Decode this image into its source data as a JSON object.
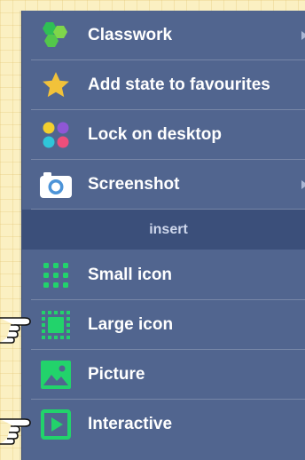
{
  "menu": {
    "items": [
      {
        "label": "Classwork",
        "icon": "green-blobs-icon",
        "has_submenu": true
      },
      {
        "label": "Add state to favourites",
        "icon": "star-icon",
        "has_submenu": false
      },
      {
        "label": "Lock on desktop",
        "icon": "colored-dots-icon",
        "has_submenu": false
      },
      {
        "label": "Screenshot",
        "icon": "camera-icon",
        "has_submenu": true
      }
    ],
    "section_header": "insert",
    "insert_items": [
      {
        "label": "Small icon",
        "icon": "dot-grid-icon"
      },
      {
        "label": "Large icon",
        "icon": "large-icon-frame-icon"
      },
      {
        "label": "Picture",
        "icon": "picture-icon"
      },
      {
        "label": "Interactive",
        "icon": "play-button-icon"
      }
    ]
  },
  "colors": {
    "menu_bg": "#51658f",
    "section_bg": "#3b4f7a",
    "accent_green": "#22d36b",
    "star_yellow": "#f2c23a",
    "page_bg": "#fbf0c2"
  }
}
